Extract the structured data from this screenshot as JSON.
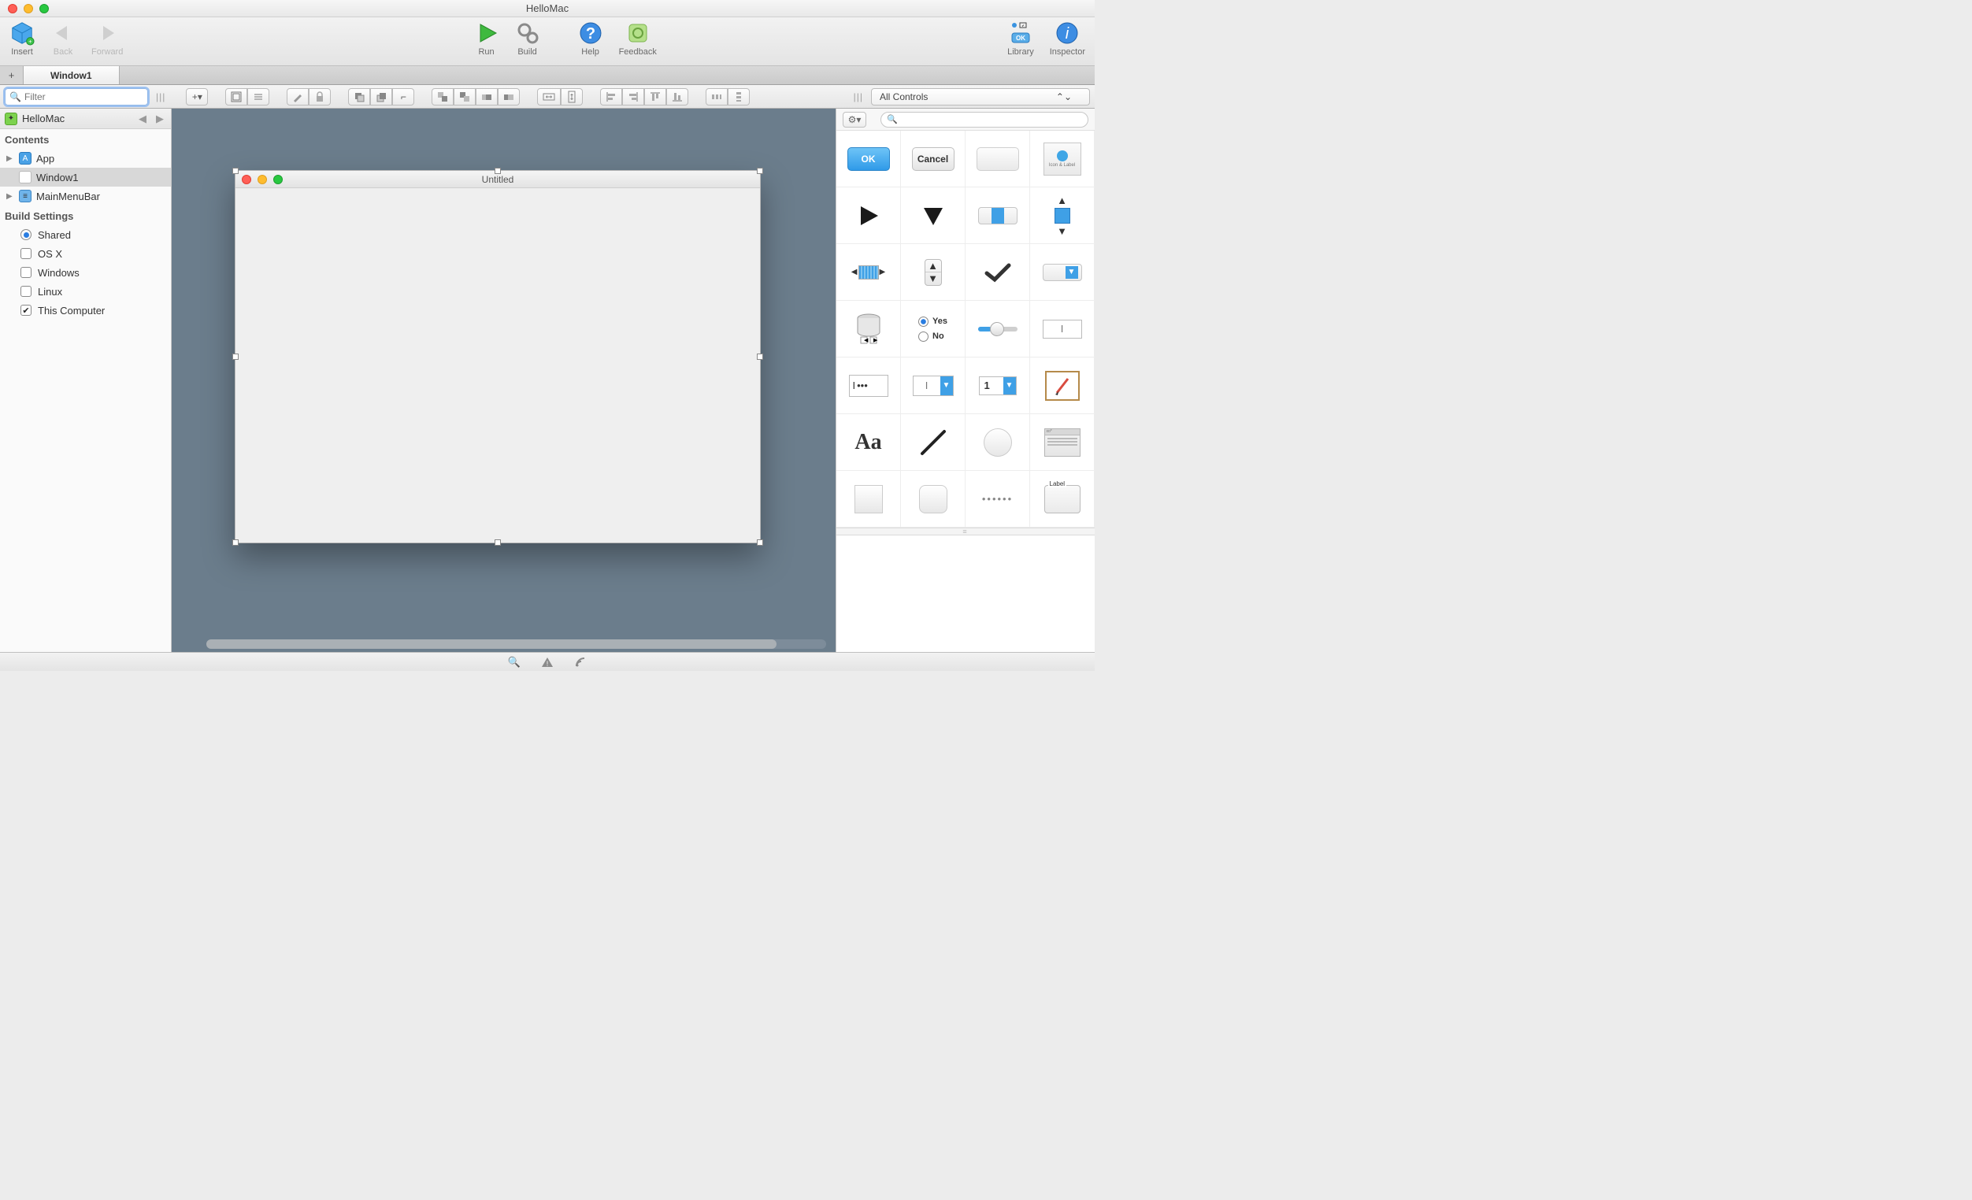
{
  "window": {
    "title": "HelloMac"
  },
  "toolbar": {
    "insert": "Insert",
    "back": "Back",
    "forward": "Forward",
    "run": "Run",
    "build": "Build",
    "help": "Help",
    "feedback": "Feedback",
    "library": "Library",
    "inspector": "Inspector"
  },
  "tabs": {
    "active": "Window1"
  },
  "filter": {
    "placeholder": "Filter"
  },
  "navigator": {
    "project": "HelloMac",
    "contents_label": "Contents",
    "items": [
      {
        "label": "App"
      },
      {
        "label": "Window1"
      },
      {
        "label": "MainMenuBar"
      }
    ],
    "build_label": "Build Settings",
    "builds": [
      {
        "label": "Shared",
        "type": "radio",
        "on": true
      },
      {
        "label": "OS X",
        "type": "check",
        "on": false
      },
      {
        "label": "Windows",
        "type": "check",
        "on": false
      },
      {
        "label": "Linux",
        "type": "check",
        "on": false
      },
      {
        "label": "This Computer",
        "type": "check",
        "on": true
      }
    ]
  },
  "canvas": {
    "window_title": "Untitled"
  },
  "library": {
    "filter_label": "All Controls",
    "search_placeholder": "",
    "controls": {
      "ok": "OK",
      "cancel": "Cancel",
      "iconlabel": "Icon & Label",
      "yes": "Yes",
      "no": "No",
      "aa": "Aa",
      "one": "1",
      "label": "Label",
      "dots": "••••••"
    }
  }
}
